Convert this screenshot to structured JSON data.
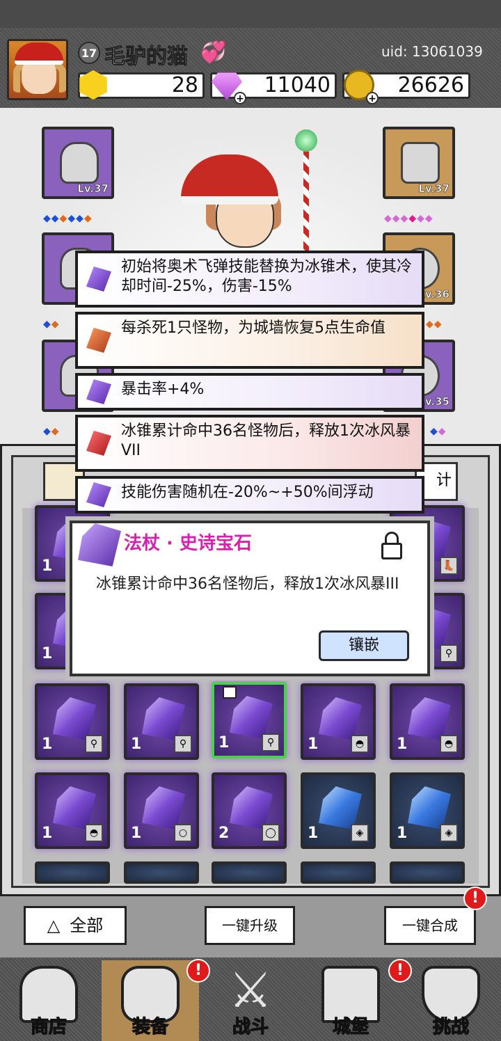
{
  "player": {
    "level": "17",
    "name": "毛驴的猫",
    "uid": "uid: 13061039"
  },
  "resources": {
    "gold": "28",
    "gems": "11040",
    "coins": "26626"
  },
  "equipment_slots": [
    {
      "level": "Lv.37",
      "quality": "purple"
    },
    {
      "level": "Lv.37",
      "quality": "orange"
    },
    {
      "level": "",
      "quality": "purple"
    },
    {
      "level": "Lv.36",
      "quality": "orange"
    },
    {
      "level": "",
      "quality": "purple"
    },
    {
      "level": "Lv.35",
      "quality": "purple"
    }
  ],
  "affixes": [
    {
      "text": "初始将奥术飞弹技能替换为冰锥术，使其冷却时间-25%，伤害-15%",
      "color": "purple"
    },
    {
      "text": "每杀死1只怪物，为城墙恢复5点生命值",
      "color": "orange"
    },
    {
      "text": "暴击率+4%",
      "color": "purple"
    },
    {
      "text": "冰锥累计命中36名怪物后，释放1次冰风暴VII",
      "color": "red"
    },
    {
      "text": "技能伤害随机在-20%~+50%间浮动",
      "color": "purple"
    }
  ],
  "inventory": {
    "filter_right_label": "计",
    "rows": [
      [
        {
          "count": "1",
          "type": "purple"
        },
        {
          "count": "",
          "type": "purple"
        },
        {
          "count": "",
          "type": "purple"
        },
        {
          "count": "",
          "type": "purple"
        },
        {
          "count": "",
          "type": "purple"
        }
      ],
      [
        {
          "count": "1",
          "type": "purple"
        },
        {
          "count": "",
          "type": "purple"
        },
        {
          "count": "",
          "type": "purple"
        },
        {
          "count": "",
          "type": "purple"
        },
        {
          "count": "",
          "type": "purple"
        }
      ],
      [
        {
          "count": "1",
          "type": "purple"
        },
        {
          "count": "1",
          "type": "purple"
        },
        {
          "count": "1",
          "type": "purple",
          "selected": true,
          "locked": true
        },
        {
          "count": "1",
          "type": "purple"
        },
        {
          "count": "1",
          "type": "purple"
        }
      ],
      [
        {
          "count": "1",
          "type": "purple"
        },
        {
          "count": "1",
          "type": "purple"
        },
        {
          "count": "2",
          "type": "purple"
        },
        {
          "count": "1",
          "type": "blue"
        },
        {
          "count": "1",
          "type": "blue"
        }
      ]
    ]
  },
  "popup": {
    "title": "法杖 · 史诗宝石",
    "description": "冰锥累计命中36名怪物后，释放1次冰风暴III",
    "inlay_button": "镶嵌"
  },
  "actions": {
    "all_label": "全部",
    "upgrade_label": "一键升级",
    "merge_label": "一键合成",
    "merge_alert": "!"
  },
  "nav": {
    "shop": "商店",
    "equipment": "装备",
    "battle": "战斗",
    "castle": "城堡",
    "challenge": "挑战",
    "alert": "!"
  },
  "colors": {
    "popup_title": "#d81fb0",
    "alert": "#e01a1a",
    "selected_border": "#4ad24a"
  }
}
